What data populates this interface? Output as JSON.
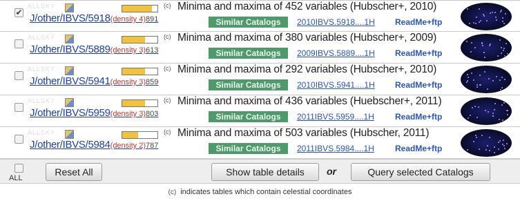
{
  "rows": [
    {
      "checked": true,
      "faint": "ALLSKY",
      "catalog": "J/other/IBVS/5918",
      "density": "(density 4)",
      "density_level": 0.85,
      "count": "891",
      "flag": "(c)",
      "title": "Minima and maxima of 452 variables (Hubscher+, 2010)",
      "similar": "Similar Catalogs",
      "bibcode": "2010IBVS.5918....1H",
      "readme": "ReadMe+ftp"
    },
    {
      "checked": false,
      "faint": "ALLSKY",
      "catalog": "J/other/IBVS/5889",
      "density": "(density 3)",
      "density_level": 0.65,
      "count": "613",
      "flag": "(c)",
      "title": "Minima and maxima of 380 variables (Hubscher+, 2009)",
      "similar": "Similar Catalogs",
      "bibcode": "2009IBVS.5889....1H",
      "readme": "ReadMe+ftp"
    },
    {
      "checked": false,
      "faint": "ALLSKY",
      "catalog": "J/other/IBVS/5941",
      "density": "(density 3)",
      "density_level": 0.65,
      "count": "859",
      "flag": "(c)",
      "title": "Minima and maxima of 292 variables (Hubscher+, 2010)",
      "similar": "Similar Catalogs",
      "bibcode": "2010IBVS.5941....1H",
      "readme": "ReadMe+ftp"
    },
    {
      "checked": false,
      "faint": "ALLSKY",
      "catalog": "J/other/IBVS/5959",
      "density": "(density 3)",
      "density_level": 0.65,
      "count": "803",
      "flag": "(c)",
      "title": "Minima and maxima of 436 variables (Huebscher+, 2011)",
      "similar": "Similar Catalogs",
      "bibcode": "2011IBVS.5959....1H",
      "readme": "ReadMe+ftp"
    },
    {
      "checked": false,
      "faint": "ALLSKY",
      "catalog": "J/other/IBVS/5984",
      "density": "(density 2)",
      "density_level": 0.45,
      "count": "787",
      "flag": "(c)",
      "title": "Minima and maxima of 503 variables (Hubscher, 2011)",
      "similar": "Similar Catalogs",
      "bibcode": "2011IBVS.5984....1H",
      "readme": "ReadMe+ftp"
    }
  ],
  "footer": {
    "all_label": "ALL",
    "reset_label": "Reset All",
    "show_details_label": "Show table details",
    "or_label": "or",
    "query_label": "Query selected Catalogs"
  },
  "note": {
    "flag": "(c)",
    "text": "indicates tables which contain celestial coordinates"
  },
  "colors": {
    "link": "#1d3fa8",
    "similar_bg": "#4f9a6a",
    "density_fill": "#f1c23c",
    "density_text": "#c0392b"
  },
  "icons": {
    "row_checkbox": "checkbox",
    "catalog_icon": "catalog-thumbnail-icon",
    "sky_map": "sky-coverage-map-icon"
  }
}
